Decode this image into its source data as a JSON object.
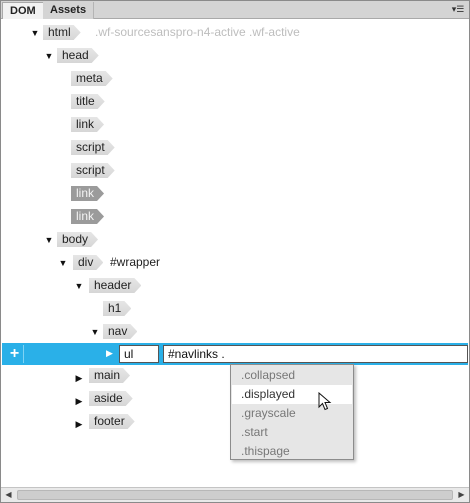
{
  "tabs": [
    {
      "label": "DOM",
      "active": true
    },
    {
      "label": "Assets",
      "active": false
    }
  ],
  "panel_menu_icon": "options-menu-icon",
  "tree": {
    "html": {
      "tag": "html",
      "attr": ".wf-sourcesanspro-n4-active .wf-active"
    },
    "head": {
      "tag": "head"
    },
    "meta": {
      "tag": "meta"
    },
    "title": {
      "tag": "title"
    },
    "link1": {
      "tag": "link"
    },
    "script1": {
      "tag": "script"
    },
    "script2": {
      "tag": "script"
    },
    "link2": {
      "tag": "link"
    },
    "link3": {
      "tag": "link"
    },
    "body": {
      "tag": "body"
    },
    "div": {
      "tag": "div",
      "attr": "#wrapper"
    },
    "header": {
      "tag": "header"
    },
    "h1": {
      "tag": "h1"
    },
    "nav": {
      "tag": "nav"
    },
    "main": {
      "tag": "main"
    },
    "aside": {
      "tag": "aside"
    },
    "footer": {
      "tag": "footer"
    }
  },
  "selected": {
    "add_button": "+",
    "tag_value": "ul",
    "selector_value": "#navlinks ."
  },
  "class_hints": [
    ".collapsed",
    ".displayed",
    ".grayscale",
    ".start",
    ".thispage"
  ],
  "highlighted_hint": ".displayed",
  "colors": {
    "selection": "#2ab0e8",
    "tag_fill": "#dcdcdc",
    "tag_dim_fill": "#9b9b9b",
    "hint_bg": "#e6e6e6"
  }
}
